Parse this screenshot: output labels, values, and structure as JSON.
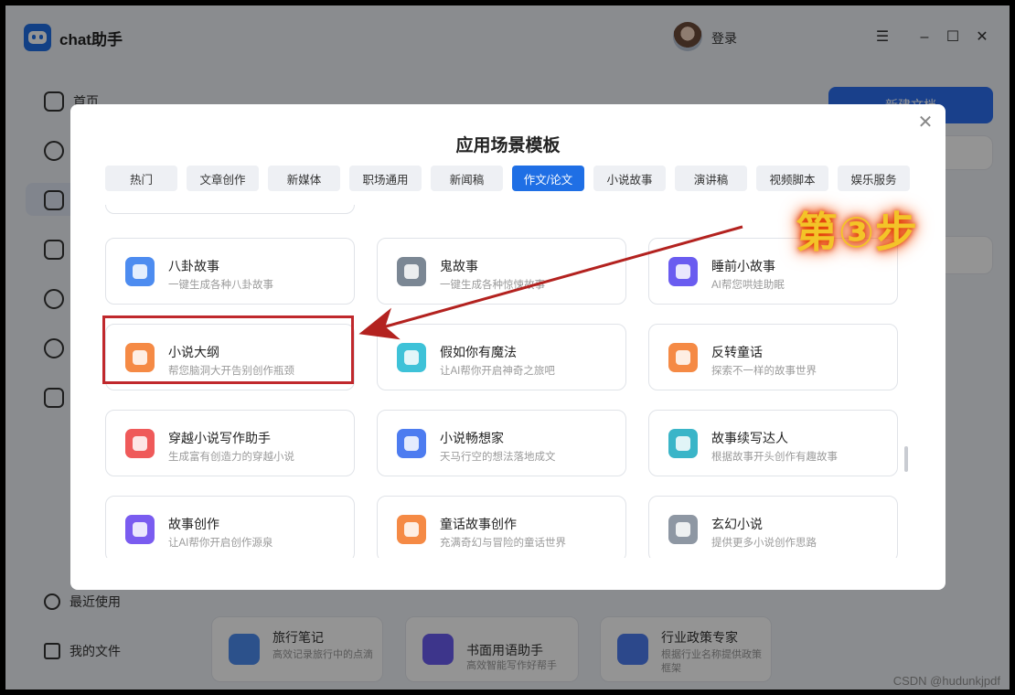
{
  "app": {
    "title": "chat助手",
    "login": "登录"
  },
  "sidebar": {
    "home": "首页",
    "recent": "最近使用",
    "files": "我的文件"
  },
  "background": {
    "new_button": "新建文档",
    "cards": [
      {
        "title": "旅行笔记",
        "desc": "高效记录旅行中的点滴"
      },
      {
        "title": "书面用语助手",
        "desc": "高效智能写作好帮手"
      },
      {
        "title": "行业政策专家",
        "desc": "根据行业名称提供政策框架"
      }
    ]
  },
  "modal": {
    "title": "应用场景模板",
    "tabs": [
      {
        "label": "热门",
        "active": false
      },
      {
        "label": "文章创作",
        "active": false
      },
      {
        "label": "新媒体",
        "active": false
      },
      {
        "label": "职场通用",
        "active": false
      },
      {
        "label": "新闻稿",
        "active": false
      },
      {
        "label": "作文/论文",
        "active": true
      },
      {
        "label": "小说故事",
        "active": false
      },
      {
        "label": "演讲稿",
        "active": false
      },
      {
        "label": "视频脚本",
        "active": false
      },
      {
        "label": "娱乐服务",
        "active": false
      }
    ],
    "cards": [
      {
        "title": "八卦故事",
        "desc": "一键生成各种八卦故事",
        "color": "#4d8cf0"
      },
      {
        "title": "鬼故事",
        "desc": "一键生成各种惊悚故事",
        "color": "#7b8794"
      },
      {
        "title": "睡前小故事",
        "desc": "AI帮您哄娃助眠",
        "color": "#6a5cf0"
      },
      {
        "title": "小说大纲",
        "desc": "帮您脑洞大开告别创作瓶颈",
        "color": "#f58a45"
      },
      {
        "title": "假如你有魔法",
        "desc": "让AI帮你开启神奇之旅吧",
        "color": "#3ec2d8"
      },
      {
        "title": "反转童话",
        "desc": "探索不一样的故事世界",
        "color": "#f58a45"
      },
      {
        "title": "穿越小说写作助手",
        "desc": "生成富有创造力的穿越小说",
        "color": "#ef5a5a"
      },
      {
        "title": "小说畅想家",
        "desc": "天马行空的想法落地成文",
        "color": "#4d7cf0"
      },
      {
        "title": "故事续写达人",
        "desc": "根据故事开头创作有趣故事",
        "color": "#3ab5c8"
      },
      {
        "title": "故事创作",
        "desc": "让AI帮你开启创作源泉",
        "color": "#7a5cf0"
      },
      {
        "title": "童话故事创作",
        "desc": "充满奇幻与冒险的童话世界",
        "color": "#f58a45"
      },
      {
        "title": "玄幻小说",
        "desc": "提供更多小说创作思路",
        "color": "#8e97a3"
      }
    ]
  },
  "annotation": {
    "step_label": "第③步"
  },
  "watermark": "CSDN @hudunkjpdf"
}
